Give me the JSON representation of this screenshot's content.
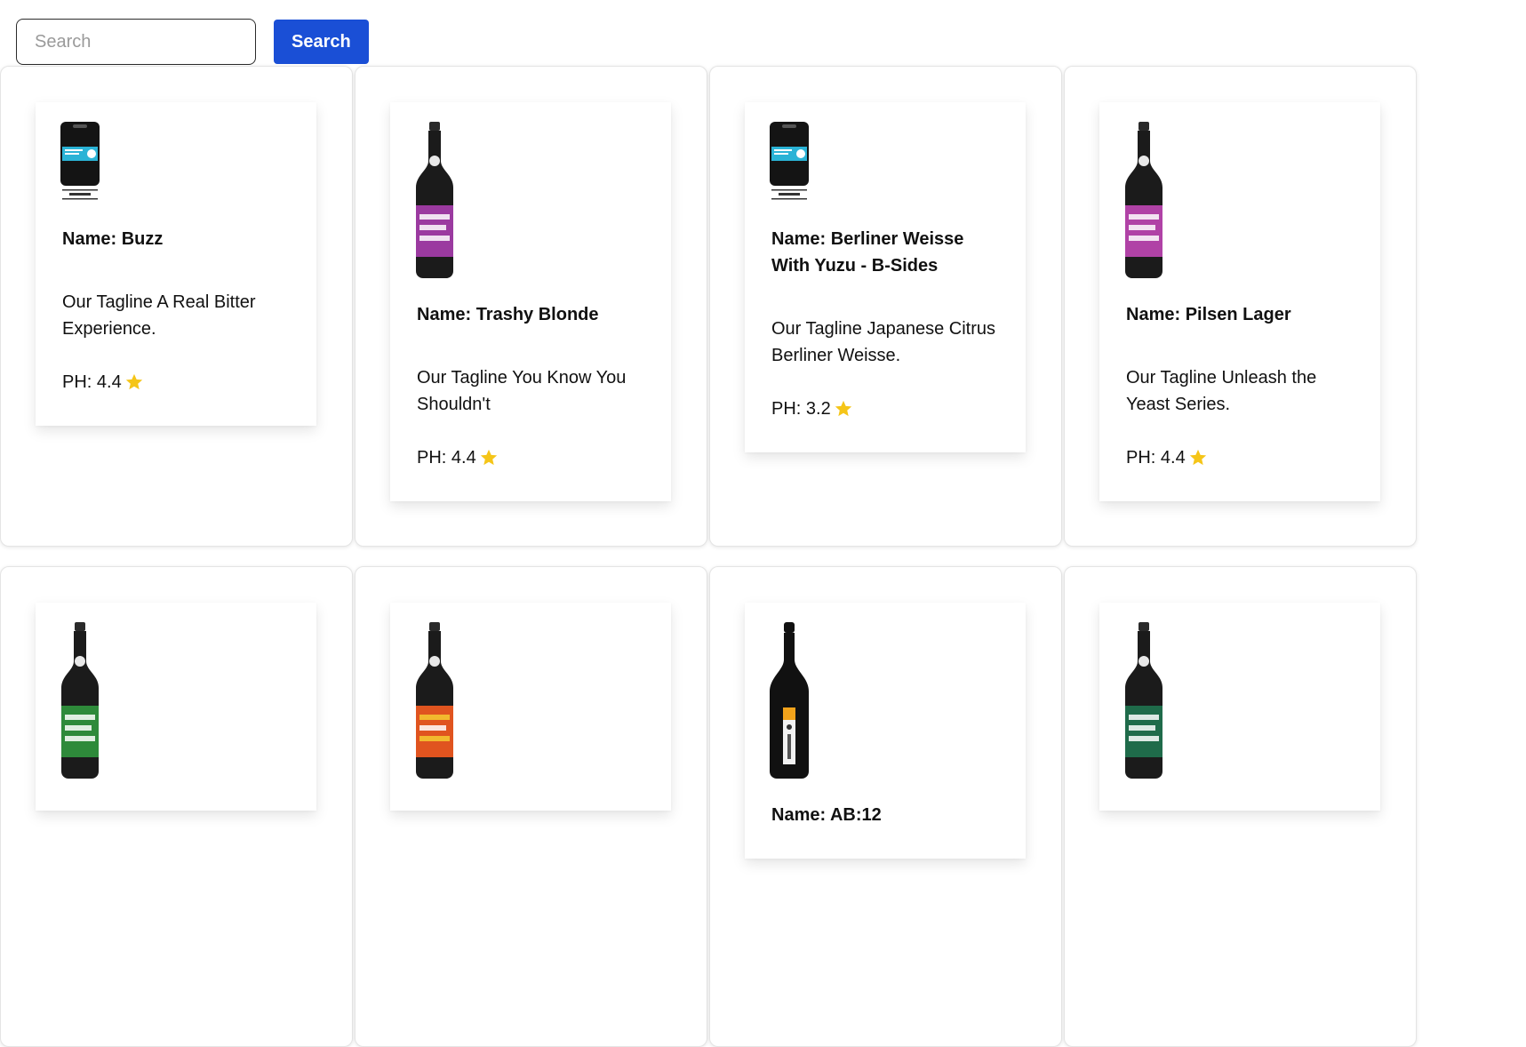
{
  "search": {
    "placeholder": "Search",
    "button_label": "Search"
  },
  "cards": [
    {
      "name": "Name: Buzz",
      "tagline": "Our Tagline A Real Bitter Experience.",
      "ph_label": "PH: 4.4",
      "image": "keg-icon",
      "label_color": "#2ab3d6"
    },
    {
      "name": "Name: Trashy Blonde",
      "tagline": "Our Tagline You Know You Shouldn't",
      "ph_label": "PH: 4.4",
      "image": "bottle-icon",
      "label_color": "#9b3aa0"
    },
    {
      "name": "Name: Berliner Weisse With Yuzu - B-Sides",
      "tagline": "Our Tagline Japanese Citrus Berliner Weisse.",
      "ph_label": "PH: 3.2",
      "image": "keg-icon",
      "label_color": "#2ab3d6"
    },
    {
      "name": "Name: Pilsen Lager",
      "tagline": "Our Tagline Unleash the Yeast Series.",
      "ph_label": "PH: 4.4",
      "image": "bottle-icon",
      "label_color": "#b042a6"
    },
    {
      "name": "",
      "tagline": "",
      "ph_label": "",
      "image": "bottle-icon",
      "label_color": "#2e8a3a"
    },
    {
      "name": "",
      "tagline": "",
      "ph_label": "",
      "image": "bottle-icon",
      "label_color": "#e0541f"
    },
    {
      "name": "Name: AB:12",
      "tagline": "",
      "ph_label": "",
      "image": "champagne-bottle-icon",
      "label_color": "#f2a31b"
    },
    {
      "name": "",
      "tagline": "",
      "ph_label": "",
      "image": "bottle-icon",
      "label_color": "#1f6b4a"
    }
  ],
  "colors": {
    "accent": "#1a4fd6",
    "star": "#f5c518"
  }
}
